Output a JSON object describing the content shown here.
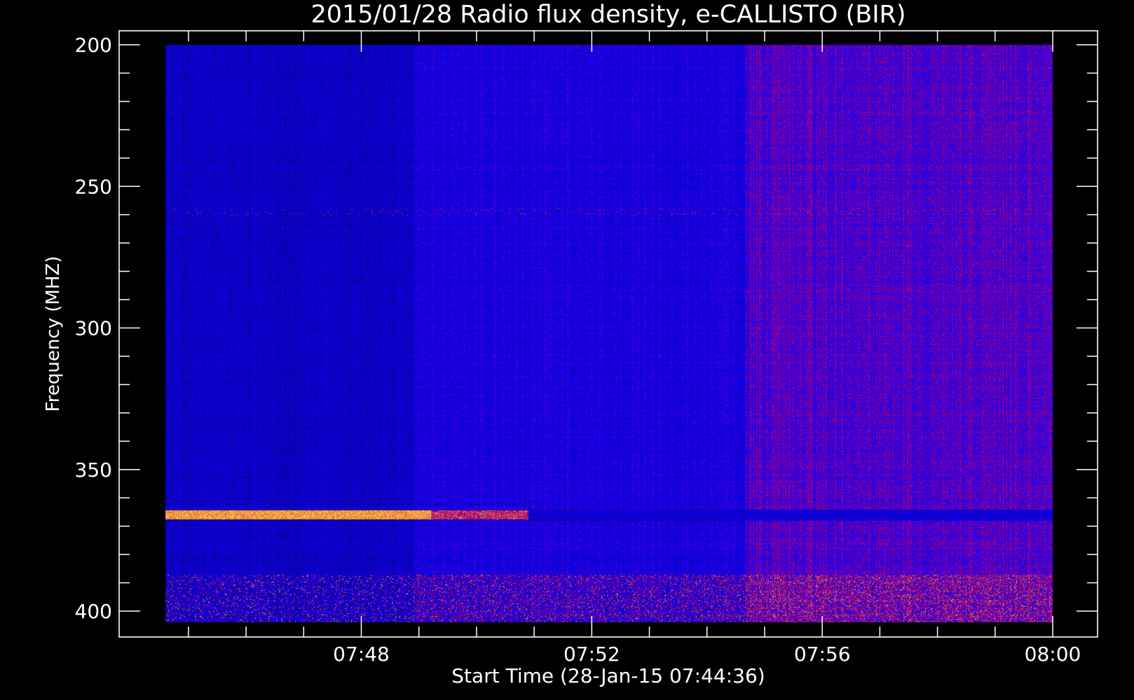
{
  "chart_data": {
    "type": "heatmap",
    "title": "2015/01/28  Radio flux density, e-CALLISTO (BIR)",
    "xlabel": "Start Time (28-Jan-15 07:44:36)",
    "ylabel": "Frequency (MHZ)",
    "x_ticks": [
      "07:48",
      "07:52",
      "07:56",
      "08:00"
    ],
    "x_tick_minutes": [
      48,
      52,
      56,
      60
    ],
    "xlim_minutes": [
      44.6,
      60
    ],
    "data_x_range_minutes": [
      44.6,
      60
    ],
    "y_ticks": [
      200,
      250,
      300,
      350,
      400
    ],
    "ylim": [
      195,
      409
    ],
    "data_y_range": [
      200,
      404
    ],
    "y_inverted": true,
    "colormap": "blue-red-yellow",
    "colors": {
      "background": "#000000",
      "axis": "#ffffff",
      "low": "#1010e0",
      "high": "#ffff40"
    },
    "segments": [
      {
        "name": "early",
        "t_start": 44.6,
        "t_end": 48.9,
        "base_color": "#1a1ab8"
      },
      {
        "name": "middle",
        "t_start": 48.9,
        "t_end": 54.65,
        "base_color": "#2a1ae0"
      },
      {
        "name": "late",
        "t_start": 54.65,
        "t_end": 60.0,
        "base_color": "#4a1a8a"
      }
    ],
    "features": [
      {
        "type": "band",
        "freq": 366,
        "t_start": 44.6,
        "t_end": 49.2,
        "intensity": "high"
      },
      {
        "type": "band",
        "freq": 366,
        "t_start": 49.2,
        "t_end": 50.9,
        "intensity": "medium"
      },
      {
        "type": "band",
        "freq": 398,
        "t_start": 44.6,
        "t_end": 60,
        "intensity": "medium"
      },
      {
        "type": "band",
        "freq": 259,
        "t_start": 44.6,
        "t_end": 60,
        "intensity": "spikes"
      }
    ]
  }
}
